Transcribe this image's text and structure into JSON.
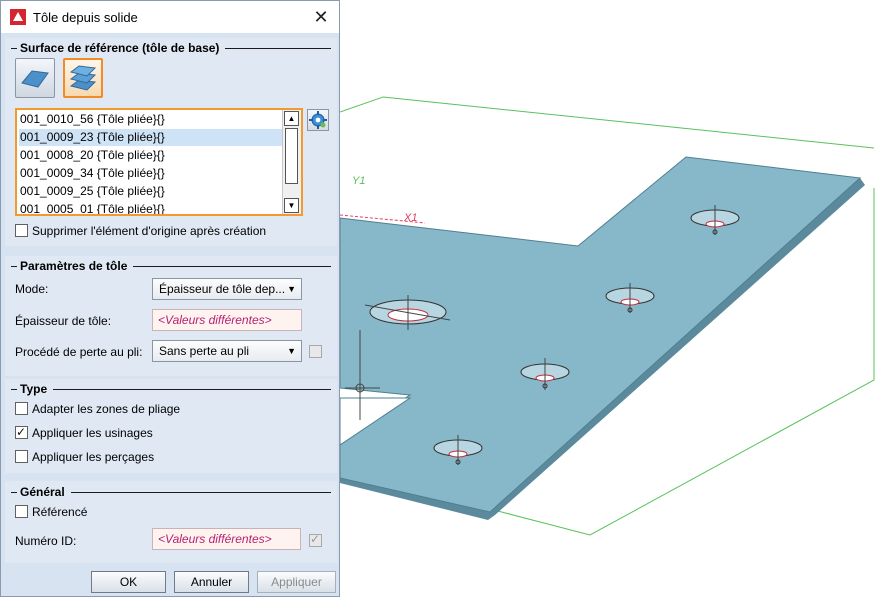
{
  "window": {
    "title": "Tôle depuis solide"
  },
  "reference_surface": {
    "heading": "Surface de référence (tôle de base)",
    "items": [
      "001_0010_56 {Tôle pliée}{}",
      "001_0009_23 {Tôle pliée}{}",
      "001_0008_20 {Tôle pliée}{}",
      "001_0009_34 {Tôle pliée}{}",
      "001_0009_25 {Tôle pliée}{}",
      "001_0005_01 {Tôle pliée}{}"
    ],
    "selected_index": 1,
    "delete_original_label": "Supprimer l'élément d'origine après création",
    "delete_original_checked": false
  },
  "sheet_params": {
    "heading": "Paramètres de tôle",
    "mode_label": "Mode:",
    "mode_value": "Épaisseur de tôle dep...",
    "thickness_label": "Épaisseur de tôle:",
    "thickness_value": "<Valeurs différentes>",
    "bend_loss_label": "Procédé de perte au pli:",
    "bend_loss_value": "Sans perte au pli"
  },
  "type": {
    "heading": "Type",
    "adapt_bend_zones": {
      "label": "Adapter les zones de pliage",
      "checked": false
    },
    "apply_machining": {
      "label": "Appliquer les usinages",
      "checked": true
    },
    "apply_holes": {
      "label": "Appliquer les perçages",
      "checked": false
    }
  },
  "general": {
    "heading": "Général",
    "referenced": {
      "label": "Référencé",
      "checked": false
    },
    "id_label": "Numéro ID:",
    "id_value": "<Valeurs différentes>"
  },
  "buttons": {
    "ok": "OK",
    "cancel": "Annuler",
    "apply": "Appliquer"
  },
  "viewport": {
    "axis_y": "Y1",
    "axis_x": "X1",
    "colors": {
      "plate": "#87b8c9",
      "plate_edge": "#5a8a9c",
      "frame": "#58c25a"
    }
  }
}
